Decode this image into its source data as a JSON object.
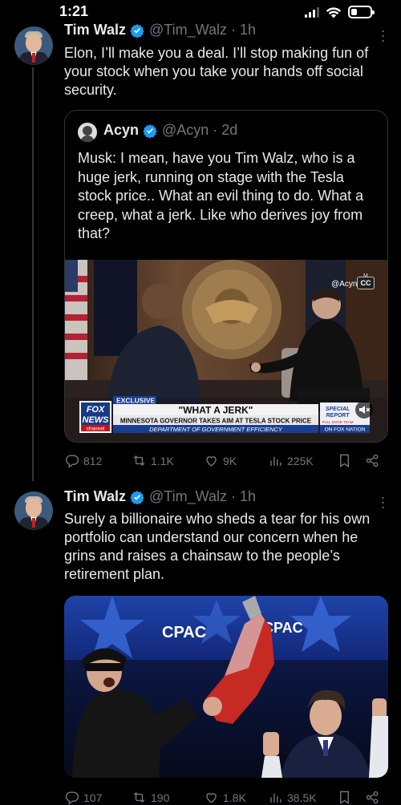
{
  "status_bar": {
    "time": "1:21",
    "battery_level": 0.3
  },
  "tweets": [
    {
      "name": "Tim Walz",
      "handle": "@Tim_Walz · 1h",
      "text": "Elon, I’ll make you a deal. I’ll stop making fun of your stock when you take your hands off social security.",
      "quote": {
        "name": "Acyn",
        "handle": "@Acyn · 2d",
        "text": "Musk: I mean, have you Tim Walz, who is a huge jerk, running on stage with the Tesla stock price..  What an evil thing to do. What a creep, what a jerk. Like who derives joy from that?",
        "media": {
          "watermark": "@Acyn",
          "cc": "CC",
          "cc_top": "M",
          "chyron_tag": "EXCLUSIVE",
          "chyron_headline": "\"WHAT A JERK\"",
          "chyron_sub": "MINNESOTA GOVERNOR TAKES AIM AT TESLA STOCK PRICE",
          "chyron_sub2": "DEPARTMENT OF GOVERNMENT EFFICIENCY",
          "logo_fox": "FOX",
          "logo_news": "NEWS",
          "logo_channel": "channel",
          "special_1": "SPECIAL",
          "special_2": "REPORT",
          "on_fox": "ON FOX NATION",
          "full_doge": "FULL DOGE TEAM"
        }
      },
      "replies": "812",
      "reposts": "1.1K",
      "likes": "9K",
      "views": "225K"
    },
    {
      "name": "Tim Walz",
      "handle": "@Tim_Walz · 1h",
      "text": "Surely a billionaire who sheds a tear for his own portfolio can understand our concern when he grins and raises a chainsaw to the people’s retirement plan.",
      "media": {
        "banner_1": "CPAC",
        "banner_2": "CPAC"
      },
      "replies": "107",
      "reposts": "190",
      "likes": "1.8K",
      "views": "38.5K"
    }
  ],
  "colors": {
    "background": "#000000",
    "text": "#e7e9ea",
    "muted": "#71767b",
    "verified": "#1d9bf0",
    "border": "#2f3336"
  }
}
